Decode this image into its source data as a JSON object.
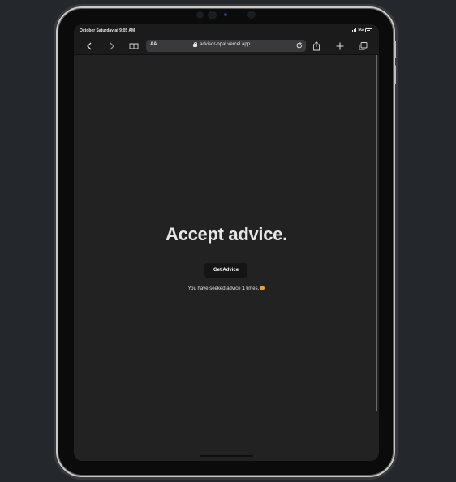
{
  "status_bar": {
    "time": "October Saturday at 9:05 AM",
    "network": "5G"
  },
  "browser": {
    "aa_label": "AA",
    "url": "advisor-opal.vercel.app"
  },
  "page": {
    "headline": "Accept advice.",
    "button_label": "Get Advice",
    "counter_prefix": "You have seeked advice",
    "counter_value": "1",
    "counter_suffix": "times."
  },
  "icons": {
    "back": "chevron-left-icon",
    "forward": "chevron-right-icon",
    "reader": "book-icon",
    "lock": "lock-icon",
    "reload": "reload-icon",
    "share": "share-icon",
    "new_tab": "plus-icon",
    "tabs": "tabs-icon",
    "emoji": "face-emoji-icon"
  }
}
